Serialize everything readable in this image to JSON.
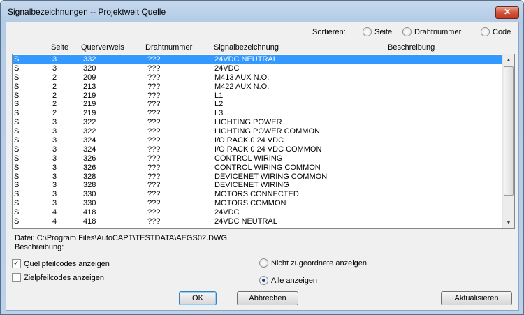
{
  "window": {
    "title": "Signalbezeichnungen -- Projektweit Quelle",
    "close_glyph": "✕"
  },
  "sort": {
    "label": "Sortieren:",
    "options": [
      {
        "label": "Seite",
        "checked": false
      },
      {
        "label": "Drahtnummer",
        "checked": false
      },
      {
        "label": "Code",
        "checked": false
      }
    ]
  },
  "table": {
    "headers": [
      "Seite",
      "Querverweis",
      "Drahtnummer",
      "Signalbezeichnung",
      "Beschreibung"
    ],
    "rows": [
      [
        "S",
        "3",
        "332",
        "???",
        "24VDC NEUTRAL"
      ],
      [
        "S",
        "3",
        "320",
        "???",
        "24VDC"
      ],
      [
        "S",
        "2",
        "209",
        "???",
        "M413 AUX N.O."
      ],
      [
        "S",
        "2",
        "213",
        "???",
        "M422 AUX N.O."
      ],
      [
        "S",
        "2",
        "219",
        "???",
        "L1"
      ],
      [
        "S",
        "2",
        "219",
        "???",
        "L2"
      ],
      [
        "S",
        "2",
        "219",
        "???",
        "L3"
      ],
      [
        "S",
        "3",
        "322",
        "???",
        "LIGHTING POWER"
      ],
      [
        "S",
        "3",
        "322",
        "???",
        "LIGHTING POWER COMMON"
      ],
      [
        "S",
        "3",
        "324",
        "???",
        "I/O RACK 0 24 VDC"
      ],
      [
        "S",
        "3",
        "324",
        "???",
        "I/O RACK 0 24 VDC COMMON"
      ],
      [
        "S",
        "3",
        "326",
        "???",
        "CONTROL WIRING"
      ],
      [
        "S",
        "3",
        "326",
        "???",
        "CONTROL WIRING COMMON"
      ],
      [
        "S",
        "3",
        "328",
        "???",
        "DEVICENET WIRING COMMON"
      ],
      [
        "S",
        "3",
        "328",
        "???",
        "DEVICENET WIRING"
      ],
      [
        "S",
        "3",
        "330",
        "???",
        "MOTORS CONNECTED"
      ],
      [
        "S",
        "3",
        "330",
        "???",
        "MOTORS COMMON"
      ],
      [
        "S",
        "4",
        "418",
        "???",
        "24VDC"
      ],
      [
        "S",
        "4",
        "418",
        "???",
        "24VDC NEUTRAL"
      ]
    ],
    "selected_index": 0
  },
  "info": {
    "datei": "Datei: C:\\Program Files\\AutoCAPT\\TESTDATA\\AEGS02.DWG",
    "beschreibung": "Beschreibung:"
  },
  "options": {
    "quell_label": "Quellpfeilcodes anzeigen",
    "quell_checked": true,
    "ziel_label": "Zielpfeilcodes anzeigen",
    "ziel_checked": false,
    "nicht_label": "Nicht zugeordnete anzeigen",
    "nicht_checked": false,
    "alle_label": "Alle anzeigen",
    "alle_checked": true
  },
  "buttons": {
    "ok": "OK",
    "cancel": "Abbrechen",
    "refresh": "Aktualisieren"
  },
  "icons": {
    "check_glyph": "✓",
    "scroll_up": "▲",
    "scroll_down": "▼"
  },
  "colors": {
    "selection": "#3399ff",
    "close": "#c13a20"
  }
}
